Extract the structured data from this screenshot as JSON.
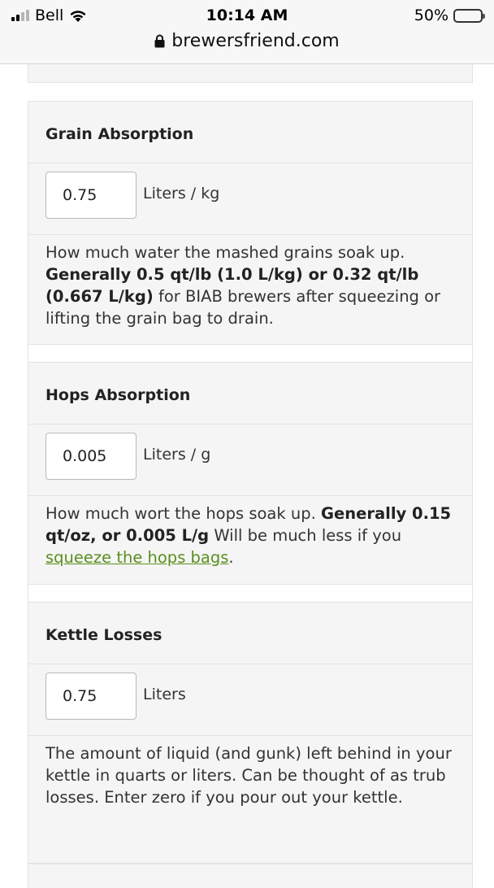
{
  "status": {
    "carrier": "Bell",
    "time": "10:14 AM",
    "battery": "50%",
    "battery_level": 0.5
  },
  "browser": {
    "url": "brewersfriend.com"
  },
  "sections": [
    {
      "title": "Grain Absorption",
      "value": "0.75",
      "unit": "Liters / kg",
      "help_plain_1": "How much water the mashed grains soak up. ",
      "help_bold": "Generally 0.5 qt/lb (1.0 L/kg) or 0.32 qt/lb (0.667 L/kg)",
      "help_plain_2": " for BIAB brewers after squeezing or lifting the grain bag to drain."
    },
    {
      "title": "Hops Absorption",
      "value": "0.005",
      "unit": "Liters / g",
      "help_plain_1": "How much wort the hops soak up. ",
      "help_bold": "Generally 0.15 qt/oz, or 0.005 L/g",
      "help_plain_2": " Will be much less if you ",
      "help_link": "squeeze the hops bags",
      "help_plain_3": "."
    },
    {
      "title": "Kettle Losses",
      "value": "0.75",
      "unit": "Liters",
      "help_plain_1": "The amount of liquid (and gunk) left behind in your kettle in quarts or liters. Can be thought of as trub losses. Enter zero if you pour out your kettle."
    }
  ]
}
